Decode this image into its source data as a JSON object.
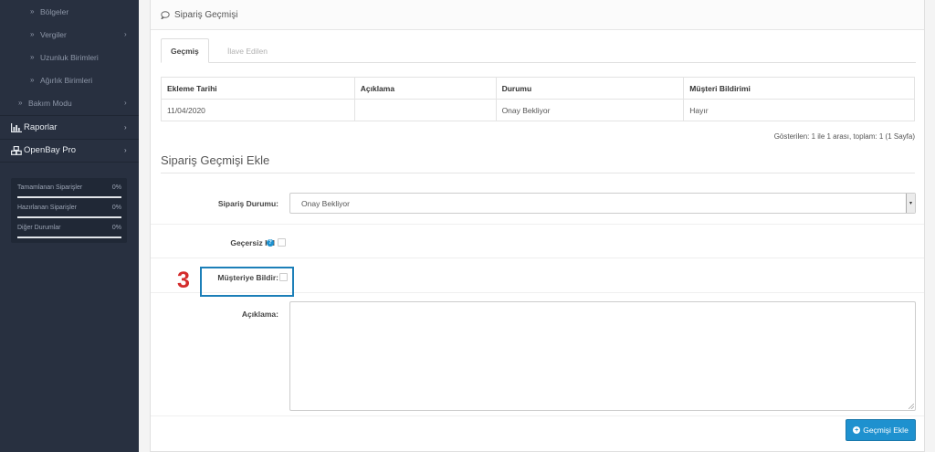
{
  "sidebar": {
    "sub_items": [
      {
        "label": "Bölgeler",
        "has_arrow": false
      },
      {
        "label": "Vergiler",
        "has_arrow": true
      },
      {
        "label": "Uzunluk Birimleri",
        "has_arrow": false
      },
      {
        "label": "Ağırlık Birimleri",
        "has_arrow": false
      }
    ],
    "maintenance": {
      "label": "Bakım Modu"
    },
    "main_items": [
      {
        "label": "Raporlar",
        "icon": "bar-chart-icon"
      },
      {
        "label": "OpenBay Pro",
        "icon": "cubes-icon"
      }
    ],
    "stats": [
      {
        "label": "Tamamlanan Siparişler",
        "value": "0%"
      },
      {
        "label": "Hazırlanan Siparişler",
        "value": "0%"
      },
      {
        "label": "Diğer Durumlar",
        "value": "0%"
      }
    ],
    "raquo": "»",
    "chevron": "›"
  },
  "panel": {
    "title": "Sipariş Geçmişi",
    "tabs": [
      {
        "label": "Geçmiş",
        "active": true
      },
      {
        "label": "İlave Edilen",
        "active": false
      }
    ],
    "table": {
      "headers": [
        "Ekleme Tarihi",
        "Açıklama",
        "Durumu",
        "Müşteri Bildirimi"
      ],
      "rows": [
        [
          "11/04/2020",
          "",
          "Onay Bekliyor",
          "Hayır"
        ]
      ]
    },
    "pager_text": "Gösterilen: 1 ile 1 arası, toplam: 1 (1 Sayfa)"
  },
  "form": {
    "section_title": "Sipariş Geçmişi Ekle",
    "status_label": "Sipariş Durumu:",
    "status_value": "Onay Bekliyor",
    "override_label": "Geçersiz Kıl",
    "override_checked": false,
    "notify_label": "Müşteriye Bildir:",
    "notify_checked": false,
    "comment_label": "Açıklama:",
    "comment_value": "",
    "submit_label": "Geçmişi Ekle"
  },
  "annotation": {
    "number": "3"
  },
  "colors": {
    "sidebar_bg": "#283040",
    "primary": "#1e91cf",
    "annotation_red": "#d42c2c",
    "annotation_box": "#1c7fb8"
  }
}
